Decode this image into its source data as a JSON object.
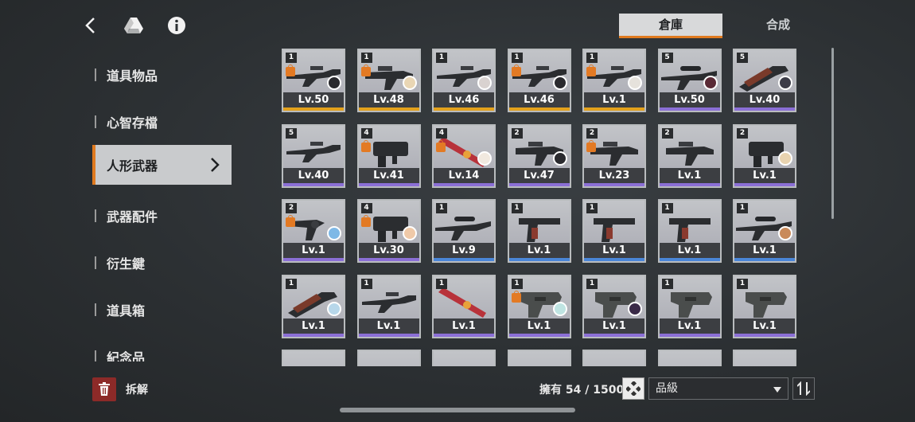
{
  "tabs": {
    "active": "倉庫",
    "inactive": "合成"
  },
  "sidebar": {
    "items": [
      {
        "label": "道具物品",
        "active": false
      },
      {
        "label": "心智存檔",
        "active": false
      },
      {
        "label": "人形武器",
        "active": true
      },
      {
        "label": "武器配件",
        "active": false
      },
      {
        "label": "衍生鍵",
        "active": false
      },
      {
        "label": "道具箱",
        "active": false
      },
      {
        "label": "紀念品",
        "active": false
      }
    ]
  },
  "dismantle": {
    "label": "拆解"
  },
  "footer": {
    "owned_label": "擁有 54 / 1500",
    "sort_value": "品級"
  },
  "colors": {
    "accent": "#e07a1f",
    "gold": "#e3a11c",
    "purple": "#8b6fd6",
    "blue": "#4a86d8"
  },
  "weapons": [
    {
      "tier": "1",
      "level": "Lv.50",
      "locked": true,
      "avatar": "#2a2a2e",
      "rarity": "gold",
      "icon": "rifle-icon"
    },
    {
      "tier": "1",
      "level": "Lv.48",
      "locked": true,
      "avatar": "#e9d6b4",
      "rarity": "gold",
      "icon": "smg-icon"
    },
    {
      "tier": "1",
      "level": "Lv.46",
      "locked": false,
      "avatar": "#d9d2d0",
      "rarity": "gold",
      "icon": "rifle-icon"
    },
    {
      "tier": "1",
      "level": "Lv.46",
      "locked": true,
      "avatar": "#2a2a2e",
      "rarity": "gold",
      "icon": "rifle-icon"
    },
    {
      "tier": "1",
      "level": "Lv.1",
      "locked": true,
      "avatar": "#e6e2dc",
      "rarity": "gold",
      "icon": "rifle-icon"
    },
    {
      "tier": "5",
      "level": "Lv.50",
      "locked": false,
      "avatar": "#5a2a36",
      "rarity": "purple",
      "icon": "sniper-icon"
    },
    {
      "tier": "5",
      "level": "Lv.40",
      "locked": false,
      "avatar": "#3c3c48",
      "rarity": "purple",
      "icon": "shotgun-icon"
    },
    {
      "tier": "5",
      "level": "Lv.40",
      "locked": false,
      "avatar": "",
      "rarity": "purple",
      "icon": "rifle-icon"
    },
    {
      "tier": "4",
      "level": "Lv.41",
      "locked": true,
      "avatar": "",
      "rarity": "purple",
      "icon": "grenade-launcher-icon"
    },
    {
      "tier": "4",
      "level": "Lv.14",
      "locked": true,
      "avatar": "#f1e9df",
      "rarity": "purple",
      "icon": "red-blade-icon"
    },
    {
      "tier": "2",
      "level": "Lv.47",
      "locked": false,
      "avatar": "#2a2a2e",
      "rarity": "purple",
      "icon": "smg-icon"
    },
    {
      "tier": "2",
      "level": "Lv.23",
      "locked": true,
      "avatar": "",
      "rarity": "purple",
      "icon": "smg-icon"
    },
    {
      "tier": "2",
      "level": "Lv.1",
      "locked": false,
      "avatar": "",
      "rarity": "purple",
      "icon": "smg-icon"
    },
    {
      "tier": "2",
      "level": "Lv.1",
      "locked": false,
      "avatar": "#e8d3b0",
      "rarity": "purple",
      "icon": "grenade-launcher-icon"
    },
    {
      "tier": "2",
      "level": "Lv.1",
      "locked": true,
      "avatar": "#7eb8e6",
      "rarity": "purple",
      "icon": "revolver-icon"
    },
    {
      "tier": "4",
      "level": "Lv.30",
      "locked": true,
      "avatar": "#efc9a8",
      "rarity": "purple",
      "icon": "grenade-launcher-icon"
    },
    {
      "tier": "1",
      "level": "Lv.9",
      "locked": false,
      "avatar": "",
      "rarity": "blue",
      "icon": "sniper-icon"
    },
    {
      "tier": "1",
      "level": "Lv.1",
      "locked": false,
      "avatar": "",
      "rarity": "blue",
      "icon": "pistol-icon"
    },
    {
      "tier": "1",
      "level": "Lv.1",
      "locked": false,
      "avatar": "",
      "rarity": "blue",
      "icon": "pistol-icon"
    },
    {
      "tier": "1",
      "level": "Lv.1",
      "locked": false,
      "avatar": "",
      "rarity": "blue",
      "icon": "pistol-icon"
    },
    {
      "tier": "1",
      "level": "Lv.1",
      "locked": false,
      "avatar": "#c98a5a",
      "rarity": "blue",
      "icon": "sniper-icon"
    },
    {
      "tier": "1",
      "level": "Lv.1",
      "locked": false,
      "avatar": "#b7d7ea",
      "rarity": "purple",
      "icon": "shotgun-icon"
    },
    {
      "tier": "1",
      "level": "Lv.1",
      "locked": false,
      "avatar": "",
      "rarity": "purple",
      "icon": "rifle-icon"
    },
    {
      "tier": "1",
      "level": "Lv.1",
      "locked": false,
      "avatar": "",
      "rarity": "purple",
      "icon": "red-blade-icon"
    },
    {
      "tier": "1",
      "level": "Lv.1",
      "locked": true,
      "avatar": "#bfe4e2",
      "rarity": "purple",
      "icon": "compact-pistol-icon"
    },
    {
      "tier": "1",
      "level": "Lv.1",
      "locked": false,
      "avatar": "#3a2a48",
      "rarity": "purple",
      "icon": "compact-pistol-icon"
    },
    {
      "tier": "1",
      "level": "Lv.1",
      "locked": false,
      "avatar": "",
      "rarity": "purple",
      "icon": "compact-pistol-icon"
    },
    {
      "tier": "1",
      "level": "Lv.1",
      "locked": false,
      "avatar": "",
      "rarity": "purple",
      "icon": "compact-pistol-icon"
    },
    {
      "tier": "",
      "level": "",
      "locked": false,
      "avatar": "",
      "rarity": "purple",
      "icon": "rifle-icon"
    },
    {
      "tier": "",
      "level": "",
      "locked": false,
      "avatar": "",
      "rarity": "purple",
      "icon": "rifle-icon"
    },
    {
      "tier": "",
      "level": "",
      "locked": false,
      "avatar": "",
      "rarity": "purple",
      "icon": "rifle-icon"
    },
    {
      "tier": "",
      "level": "",
      "locked": false,
      "avatar": "",
      "rarity": "purple",
      "icon": "rifle-icon"
    },
    {
      "tier": "",
      "level": "",
      "locked": false,
      "avatar": "",
      "rarity": "purple",
      "icon": "rifle-icon"
    },
    {
      "tier": "",
      "level": "",
      "locked": false,
      "avatar": "",
      "rarity": "purple",
      "icon": "rifle-icon"
    },
    {
      "tier": "",
      "level": "",
      "locked": false,
      "avatar": "",
      "rarity": "purple",
      "icon": "rifle-icon"
    }
  ]
}
